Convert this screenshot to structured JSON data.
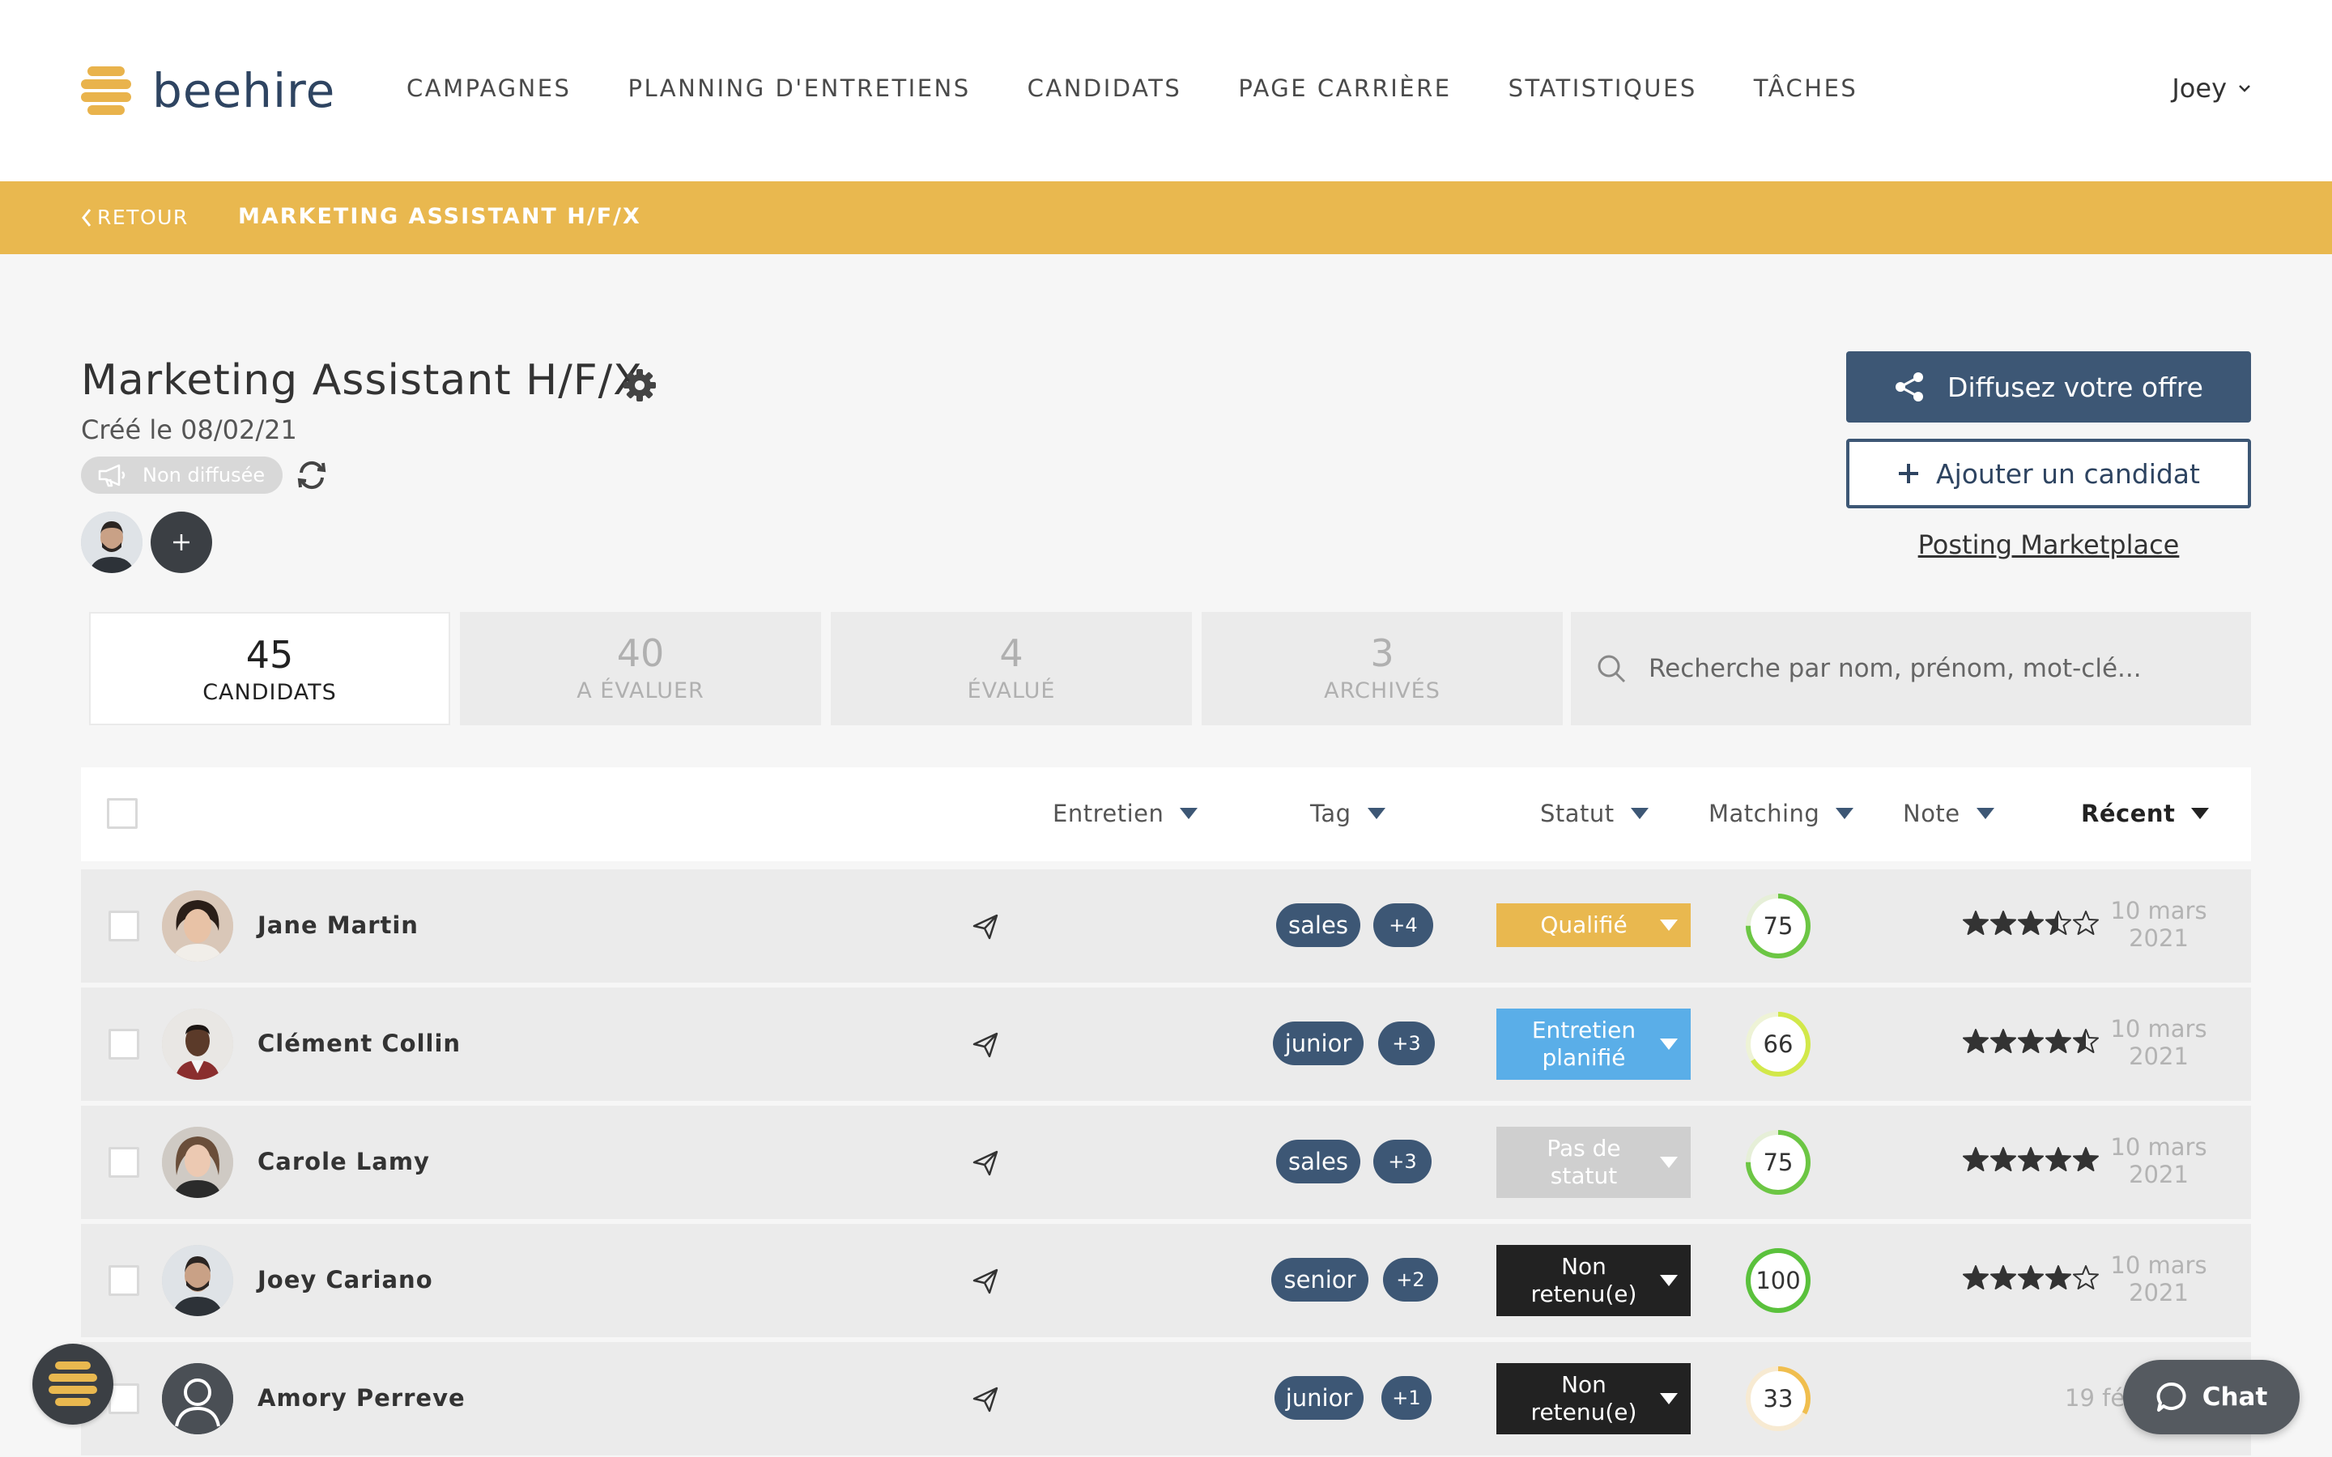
{
  "brand": {
    "name": "beehire",
    "accent": "#e9b84f",
    "primary": "#3d5775"
  },
  "nav": {
    "items": [
      "CAMPAGNES",
      "PLANNING D'ENTRETIENS",
      "CANDIDATS",
      "PAGE CARRIÈRE",
      "STATISTIQUES",
      "TÂCHES"
    ],
    "user": "Joey"
  },
  "subbar": {
    "back": "RETOUR",
    "crumb": "MARKETING ASSISTANT H/F/X"
  },
  "job": {
    "title": "Marketing Assistant H/F/X",
    "created": "Créé le 08/02/21",
    "diffusion_status": "Non diffusée"
  },
  "actions": {
    "share": "Diffusez votre offre",
    "add_candidate": "Ajouter un candidat",
    "marketplace": "Posting Marketplace"
  },
  "tabs": [
    {
      "count": "45",
      "label": "CANDIDATS",
      "active": true
    },
    {
      "count": "40",
      "label": "A ÉVALUER"
    },
    {
      "count": "4",
      "label": "ÉVALUÉ"
    },
    {
      "count": "3",
      "label": "ARCHIVÉS"
    }
  ],
  "search": {
    "placeholder": "Recherche par nom, prénom, mot-clé..."
  },
  "columns": {
    "interview": "Entretien",
    "tag": "Tag",
    "status": "Statut",
    "matching": "Matching",
    "rating": "Note",
    "recent": "Récent"
  },
  "candidates": [
    {
      "name": "Jane Martin",
      "tag": "sales",
      "tag_more": "+4",
      "status": "Qualifié",
      "status_color": "#e9b84f",
      "matching": 75,
      "rating": 3.5,
      "date": "10 mars 2021",
      "date_l1": "10 mars",
      "date_l2": "2021"
    },
    {
      "name": "Clément Collin",
      "tag": "junior",
      "tag_more": "+3",
      "status": "Entretien planifié",
      "status_l1": "Entretien",
      "status_l2": "planifié",
      "status_color": "#5aaee8",
      "matching": 66,
      "rating": 4.5,
      "date": "10 mars 2021",
      "date_l1": "10 mars",
      "date_l2": "2021"
    },
    {
      "name": "Carole Lamy",
      "tag": "sales",
      "tag_more": "+3",
      "status": "Pas de statut",
      "status_l1": "Pas de",
      "status_l2": "statut",
      "status_color": "#cfcfcf",
      "matching": 75,
      "rating": 5,
      "date": "10 mars 2021",
      "date_l1": "10 mars",
      "date_l2": "2021"
    },
    {
      "name": "Joey Cariano",
      "tag": "senior",
      "tag_more": "+2",
      "status": "Non retenu(e)",
      "status_l1": "Non",
      "status_l2": "retenu(e)",
      "status_color": "#222222",
      "matching": 100,
      "rating": 4,
      "date": "10 mars 2021",
      "date_l1": "10 mars",
      "date_l2": "2021"
    },
    {
      "name": "Amory Perreve",
      "tag": "junior",
      "tag_more": "+1",
      "status": "Non retenu(e)",
      "status_l1": "Non",
      "status_l2": "retenu(e)",
      "status_color": "#222222",
      "matching": 33,
      "rating": 0,
      "date": "19 fé",
      "date_l1": "19 fé",
      "date_l2": ""
    }
  ],
  "chat": {
    "label": "Chat"
  }
}
